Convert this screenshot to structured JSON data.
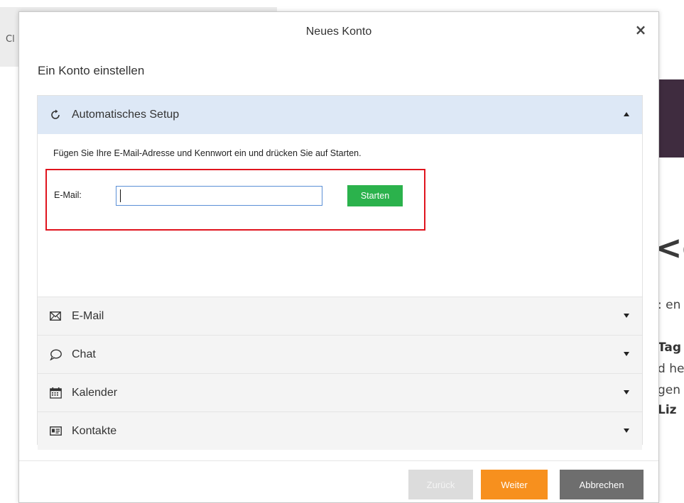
{
  "background": {
    "left_fragment": "Cl",
    "right_fragments": [
      "<e",
      ": en",
      "Tag",
      "d he",
      "gen",
      "Liz"
    ]
  },
  "dialog": {
    "title": "Neues Konto",
    "close_symbol": "×",
    "subtitle": "Ein Konto einstellen"
  },
  "accordion": {
    "auto_setup": {
      "label": "Automatisches Setup",
      "icon": "refresh-icon",
      "instruction": "Fügen Sie Ihre E-Mail-Adresse und Kennwort ein und drücken Sie auf Starten.",
      "email_label": "E-Mail:",
      "email_value": "",
      "email_placeholder": "",
      "start_label": "Starten"
    },
    "items": [
      {
        "label": "E-Mail",
        "icon": "envelope-icon"
      },
      {
        "label": "Chat",
        "icon": "chat-bubble-icon"
      },
      {
        "label": "Kalender",
        "icon": "calendar-icon"
      },
      {
        "label": "Kontakte",
        "icon": "contact-card-icon"
      }
    ]
  },
  "footer": {
    "back_label": "Zurück",
    "next_label": "Weiter",
    "cancel_label": "Abbrechen"
  },
  "colors": {
    "active_header": "#dde8f6",
    "start_button": "#2bb24c",
    "next_button": "#f7901e",
    "cancel_button": "#6e6e6e",
    "highlight_border": "#e0141e"
  }
}
